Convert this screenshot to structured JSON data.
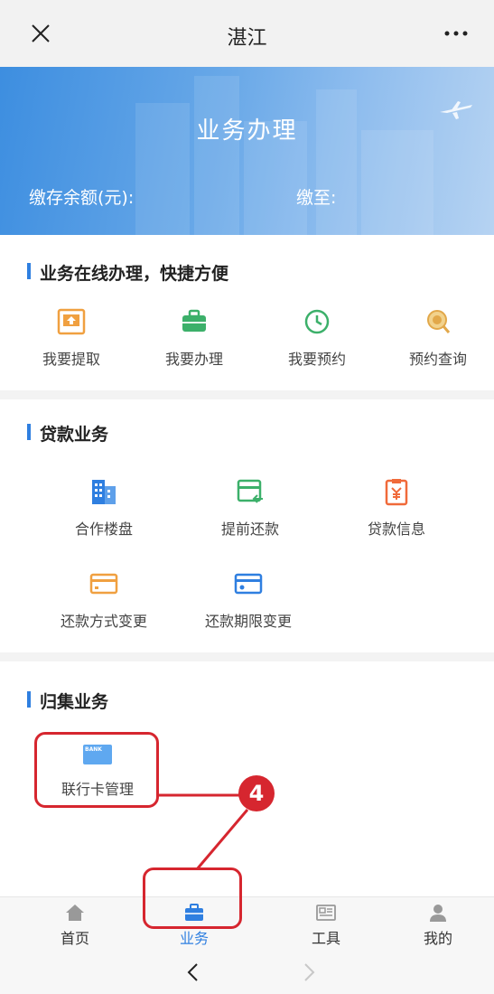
{
  "header": {
    "title": "湛江"
  },
  "banner": {
    "heading": "业务办理",
    "balance_label": "缴存余额(元):",
    "paid_to_label": "缴至:"
  },
  "section_online": {
    "title": "业务在线办理，快捷方便",
    "items": [
      {
        "label": "我要提取",
        "icon": "withdraw-icon"
      },
      {
        "label": "我要办理",
        "icon": "briefcase-icon"
      },
      {
        "label": "我要预约",
        "icon": "clock-icon"
      },
      {
        "label": "预约查询",
        "icon": "search-icon"
      }
    ]
  },
  "section_loan": {
    "title": "贷款业务",
    "items": [
      {
        "label": "合作楼盘",
        "icon": "building-icon"
      },
      {
        "label": "提前还款",
        "icon": "card-return-icon"
      },
      {
        "label": "贷款信息",
        "icon": "yen-clipboard-icon"
      },
      {
        "label": "还款方式变更",
        "icon": "card-icon"
      },
      {
        "label": "还款期限变更",
        "icon": "card-icon"
      }
    ]
  },
  "section_collect": {
    "title": "归集业务",
    "items": [
      {
        "label": "联行卡管理",
        "icon": "bank-card-icon",
        "icon_text": "BANK"
      }
    ]
  },
  "bottom_nav": {
    "tabs": [
      {
        "label": "首页",
        "icon": "home-icon"
      },
      {
        "label": "业务",
        "icon": "briefcase-icon",
        "active": true
      },
      {
        "label": "工具",
        "icon": "toolbox-icon"
      },
      {
        "label": "我的",
        "icon": "user-icon"
      }
    ]
  },
  "annotation": {
    "step": "4"
  },
  "colors": {
    "accent": "#2f7fe0",
    "highlight": "#d6262f",
    "orange": "#f0a040",
    "green": "#3cb06a"
  }
}
